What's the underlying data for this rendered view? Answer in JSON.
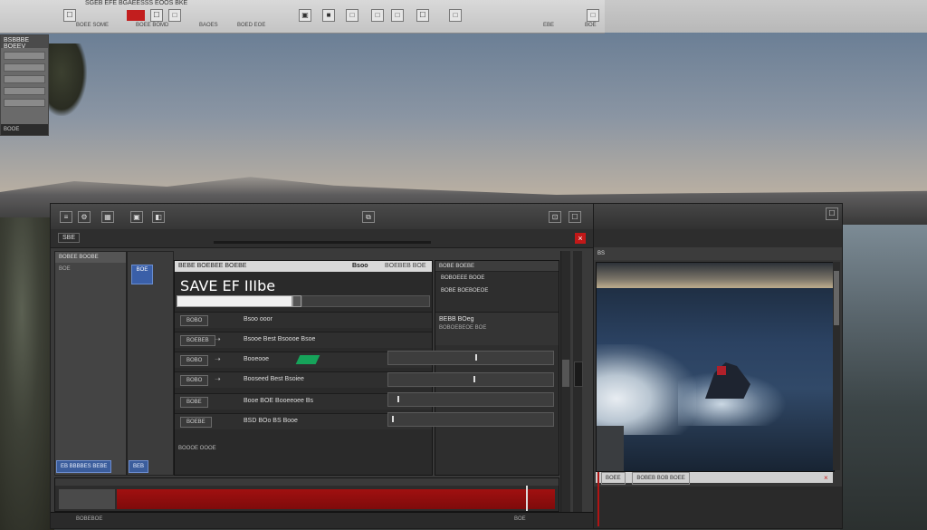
{
  "topbar": {
    "title": "SGEB EFE BGAEESSS EOOS BKE",
    "sub_labels": [
      "BOEE SOME",
      "BOEE BOMD",
      "BAOES",
      "BOED EOE",
      "EBE",
      "BOE"
    ],
    "buttons": [
      "☐",
      "☐",
      "□",
      "▣",
      "■",
      "□",
      "□",
      "□",
      "☐",
      "□",
      "□"
    ]
  },
  "mini_panel": {
    "title": "BSBBBE BOEEV",
    "footer": "BOOE"
  },
  "window": {
    "tab_label": "SBE",
    "side_left_header": "BOBEE BOOBE",
    "side_left_items": [
      "BOE"
    ],
    "chip_label": "BOE",
    "status_chip": "EB BBBBES BEBE",
    "status_chip_small": "BEB",
    "editor": {
      "header_left": "BEBE BOEBEE BOEBE",
      "header_right": "Bsoo",
      "header_right_sub": "BOEBEB BOE",
      "big_text": "SAVE EF IIIbe",
      "rows": [
        {
          "key": "BOBO",
          "value": "Bsoo ooor"
        },
        {
          "key": "BOEBEB",
          "value": "Bsooe Best Bsoooe Bsoe"
        },
        {
          "key": "BOBO",
          "value": "Booeooe"
        },
        {
          "key": "BOBO",
          "value": "Booseed Best Bsoiee"
        },
        {
          "key": "BOBE",
          "value": "Booe BOE Booeeoee Bs"
        },
        {
          "key": "BOEBE",
          "value": "BSD BOo BS Booe"
        }
      ],
      "footer": "BOOOE OOOE"
    },
    "right_col": {
      "bar_label": "BOBE BOEBE",
      "items": [
        "BOBOEEE BOOE",
        "BOBE BOEBOEOE"
      ],
      "box_title": "BEBB BOeg",
      "box_sub": "BOBOEBEOE BOE"
    },
    "status_left": "BOBEBOE",
    "status_right": "BOE"
  },
  "preview": {
    "head_label": "BS",
    "footer_chips": [
      "BOEE",
      "BOBEB BOB BOEE"
    ],
    "footer_red": "×",
    "close": "☐"
  }
}
